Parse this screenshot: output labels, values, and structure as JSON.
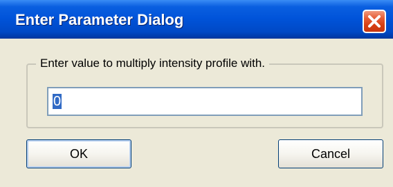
{
  "window": {
    "title": "Enter Parameter Dialog",
    "close_icon": "close-icon"
  },
  "group": {
    "label": "Enter value to multiply intensity profile with."
  },
  "input": {
    "value": "0",
    "selected": true
  },
  "buttons": {
    "ok_label": "OK",
    "cancel_label": "Cancel"
  },
  "colors": {
    "titlebar": "#0053d9",
    "close_button": "#d53e12",
    "dialog_background": "#ece9d8",
    "selection": "#316ac5"
  }
}
